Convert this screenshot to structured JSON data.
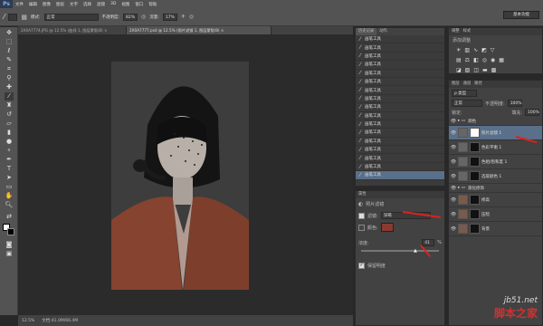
{
  "app": {
    "logo": "Ps"
  },
  "menu": [
    "文件",
    "编辑",
    "图像",
    "图层",
    "文字",
    "选择",
    "滤镜",
    "3D",
    "视图",
    "窗口",
    "帮助"
  ],
  "options": {
    "mode_label": "模式:",
    "mode_value": "正常",
    "opacity_label": "不透明度:",
    "opacity_value": "82%",
    "flow_label": "流量:",
    "flow_value": "17%",
    "workspace": "基本功能"
  },
  "tabs": [
    "2X0A7774.JPG @ 12.5% (曲线 1, 图层蒙版/8) ×",
    "2X0A7777.psd @ 12.5% (照片滤镜 1, 图层蒙版/8) ×"
  ],
  "status": {
    "zoom": "12.5%",
    "doc": "文档:41.0M/66.4M"
  },
  "history": {
    "tabs": [
      "历史记录",
      "动作"
    ],
    "item_label": "画笔工具",
    "item_count": 17
  },
  "adjust": {
    "tabs": [
      "调整",
      "样式"
    ],
    "title": "添加调整"
  },
  "properties": {
    "tabs": [
      "属性"
    ],
    "title": "照片滤镜",
    "filter_label": "滤镜:",
    "filter_value": "深褐",
    "color_label": "颜色:",
    "density_label": "浓度:",
    "density_value": "41",
    "percent": "%",
    "preserve_label": "保留明度"
  },
  "layers": {
    "tabs": [
      "图层",
      "通道",
      "路径"
    ],
    "kind": "ρ 类型",
    "blend": "正常",
    "opacity_label": "不透明度:",
    "opacity_value": "100%",
    "lock_label": "锁定:",
    "fill_label": "填充:",
    "fill_value": "100%",
    "items": [
      {
        "name": "调色",
        "type": "group"
      },
      {
        "name": "照片滤镜 1",
        "type": "adj"
      },
      {
        "name": "色彩平衡 1",
        "type": "adj"
      },
      {
        "name": "色相/饱和度 1",
        "type": "adj"
      },
      {
        "name": "选取颜色 1",
        "type": "adj"
      },
      {
        "name": "液化修饰",
        "type": "group"
      },
      {
        "name": "修高",
        "type": "layer"
      },
      {
        "name": "压暗",
        "type": "layer"
      },
      {
        "name": "背景",
        "type": "layer"
      }
    ]
  },
  "colors": {
    "accent": "#e02020",
    "brand": "#7fb2f0",
    "photo_tone": "#8a4a36"
  },
  "watermark": {
    "site": "jb51.net",
    "name": "脚本之家"
  }
}
